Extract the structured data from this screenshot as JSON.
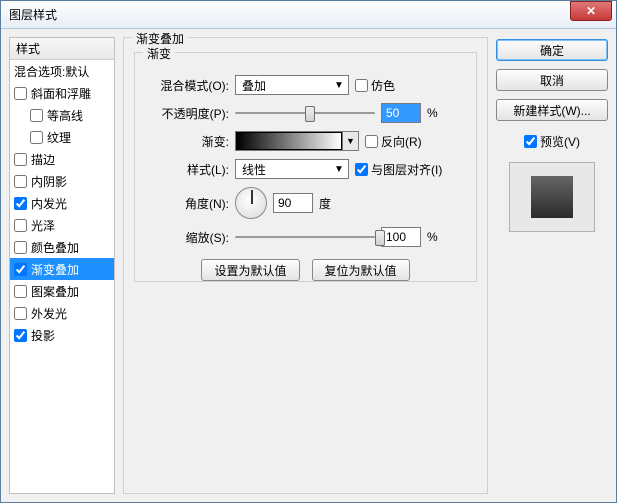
{
  "window": {
    "title": "图层样式"
  },
  "sidebar": {
    "header": "样式",
    "blend_defaults": "混合选项:默认",
    "items": [
      {
        "label": "斜面和浮雕",
        "checked": false,
        "selected": false,
        "indent": false
      },
      {
        "label": "等高线",
        "checked": false,
        "selected": false,
        "indent": true
      },
      {
        "label": "纹理",
        "checked": false,
        "selected": false,
        "indent": true
      },
      {
        "label": "描边",
        "checked": false,
        "selected": false,
        "indent": false
      },
      {
        "label": "内阴影",
        "checked": false,
        "selected": false,
        "indent": false
      },
      {
        "label": "内发光",
        "checked": true,
        "selected": false,
        "indent": false
      },
      {
        "label": "光泽",
        "checked": false,
        "selected": false,
        "indent": false
      },
      {
        "label": "颜色叠加",
        "checked": false,
        "selected": false,
        "indent": false
      },
      {
        "label": "渐变叠加",
        "checked": true,
        "selected": true,
        "indent": false
      },
      {
        "label": "图案叠加",
        "checked": false,
        "selected": false,
        "indent": false
      },
      {
        "label": "外发光",
        "checked": false,
        "selected": false,
        "indent": false
      },
      {
        "label": "投影",
        "checked": true,
        "selected": false,
        "indent": false
      }
    ]
  },
  "group": {
    "outer_title": "渐变叠加",
    "inner_title": "渐变",
    "blend_mode_label": "混合模式(O):",
    "blend_mode_value": "叠加",
    "dither_label": "仿色",
    "opacity_label": "不透明度(P):",
    "opacity_value": "50",
    "percent": "%",
    "gradient_label": "渐变:",
    "reverse_label": "反向(R)",
    "style_label": "样式(L):",
    "style_value": "线性",
    "align_label": "与图层对齐(I)",
    "align_checked": true,
    "angle_label": "角度(N):",
    "angle_value": "90",
    "degree": "度",
    "scale_label": "缩放(S):",
    "scale_value": "100",
    "btn_default": "设置为默认值",
    "btn_reset": "复位为默认值"
  },
  "right": {
    "ok": "确定",
    "cancel": "取消",
    "new_style": "新建样式(W)...",
    "preview_label": "预览(V)",
    "preview_checked": true
  }
}
